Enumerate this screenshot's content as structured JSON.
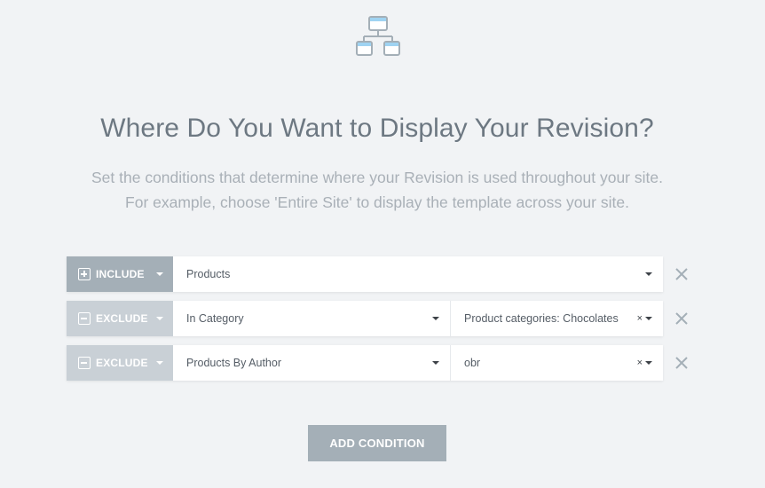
{
  "header": {
    "icon": "sitemap-icon",
    "title": "Where Do You Want to Display Your Revision?",
    "subtitle_line1": "Set the conditions that determine where your Revision is used throughout your site.",
    "subtitle_line2": "For example, choose 'Entire Site' to display the template across your site."
  },
  "conditions": [
    {
      "type": "INCLUDE",
      "type_icon": "plus-icon",
      "value": "Products"
    },
    {
      "type": "EXCLUDE",
      "type_icon": "minus-icon",
      "value": "In Category",
      "sub_value": "Product categories: Chocolates"
    },
    {
      "type": "EXCLUDE",
      "type_icon": "minus-icon",
      "value": "Products By Author",
      "sub_value": "obr"
    }
  ],
  "clear_symbol": "×",
  "add_condition_label": "ADD CONDITION",
  "colors": {
    "background": "#f1f3f5",
    "include": "#a4afb7",
    "exclude": "#c9d0d6",
    "title": "#6d7882",
    "subtitle": "#a9b0b7",
    "icon_accent": "#9fd3f2"
  }
}
